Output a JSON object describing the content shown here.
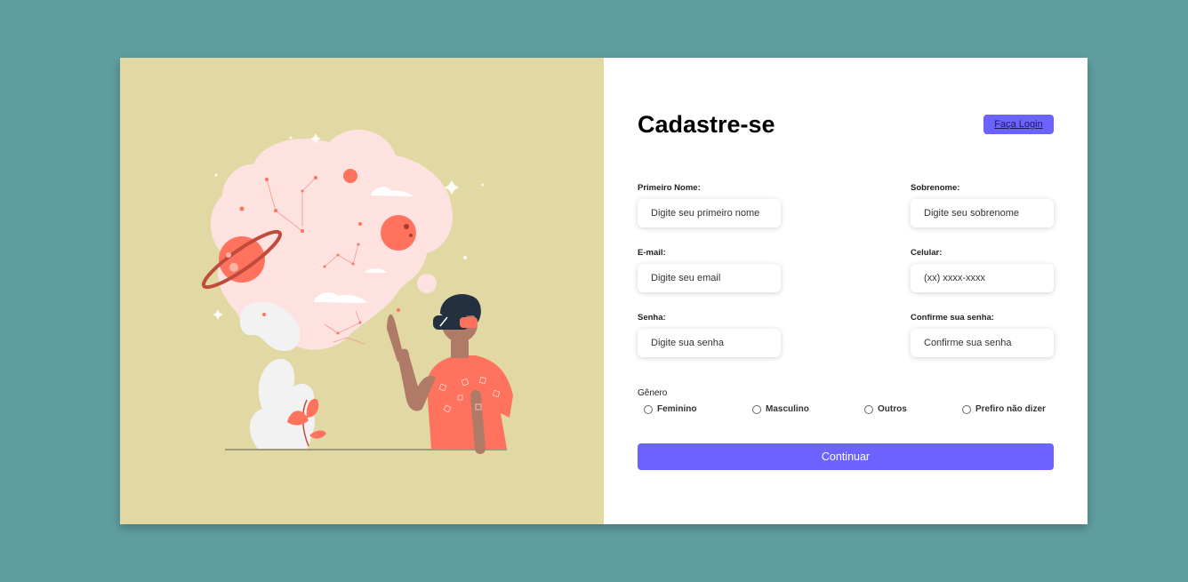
{
  "form": {
    "title": "Cadastre-se",
    "login_label": "Faça Login",
    "fields": {
      "first_name": {
        "label": "Primeiro Nome:",
        "placeholder": "Digite seu primeiro nome"
      },
      "last_name": {
        "label": "Sobrenome:",
        "placeholder": "Digite seu sobrenome"
      },
      "email": {
        "label": "E-mail:",
        "placeholder": "Digite seu email"
      },
      "phone": {
        "label": "Celular:",
        "placeholder": "(xx) xxxx-xxxx"
      },
      "password": {
        "label": "Senha:",
        "placeholder": "Digite sua senha"
      },
      "confirm_password": {
        "label": "Confirme sua senha:",
        "placeholder": "Confirme sua senha"
      }
    },
    "gender": {
      "title": "Gênero",
      "options": [
        "Feminino",
        "Masculino",
        "Outros",
        "Prefiro não dizer"
      ]
    },
    "continue_label": "Continuar"
  },
  "colors": {
    "background": "#5f9ea0",
    "illustration_panel": "#e1d8a4",
    "accent": "#6c63ff",
    "coral": "#ff725e"
  }
}
